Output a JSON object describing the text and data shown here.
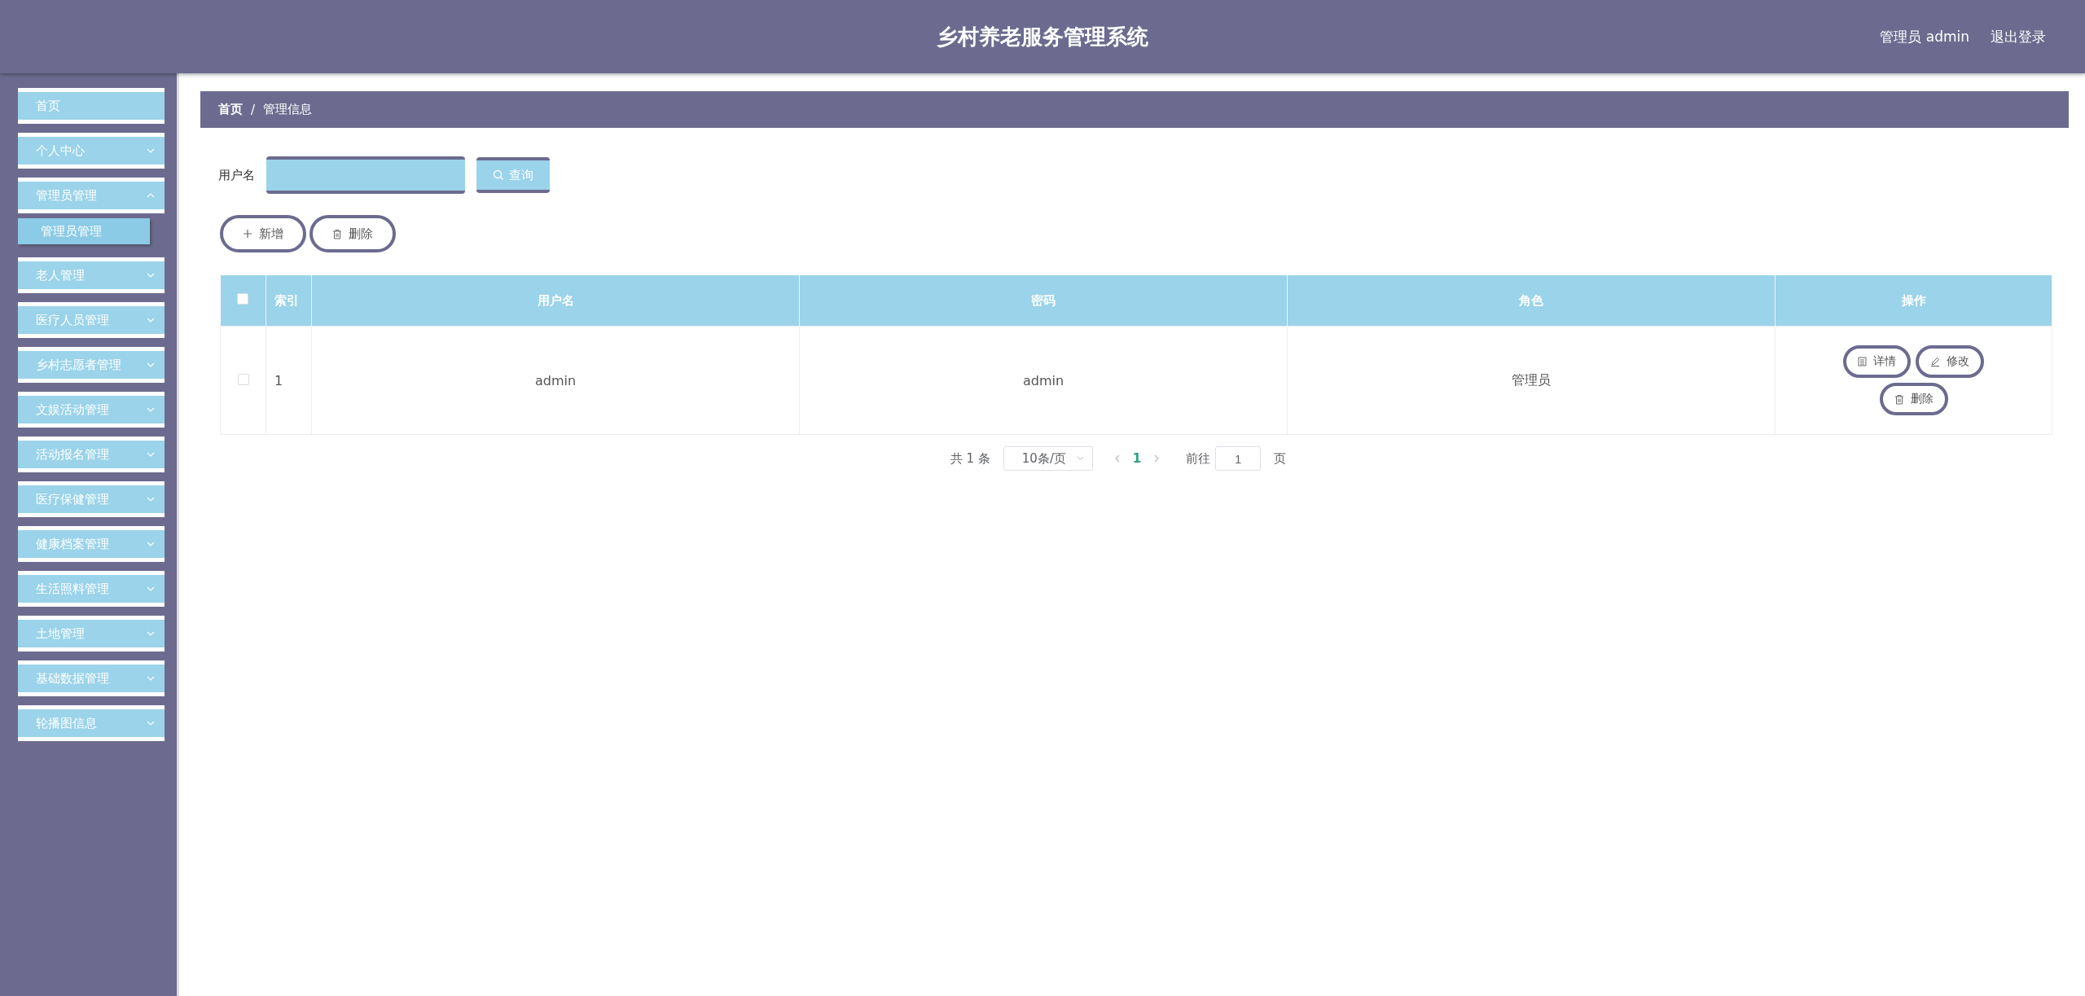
{
  "header": {
    "title": "乡村养老服务管理系统",
    "user": "管理员 admin",
    "logout": "退出登录"
  },
  "sidebar": {
    "items": [
      {
        "label": "首页",
        "kind": "link"
      },
      {
        "label": "个人中心",
        "kind": "menu",
        "expanded": false
      },
      {
        "label": "管理员管理",
        "kind": "menu",
        "expanded": true,
        "children": [
          {
            "label": "管理员管理",
            "selected": true
          }
        ]
      },
      {
        "label": "老人管理",
        "kind": "menu",
        "expanded": false
      },
      {
        "label": "医疗人员管理",
        "kind": "menu",
        "expanded": false
      },
      {
        "label": "乡村志愿者管理",
        "kind": "menu",
        "expanded": false
      },
      {
        "label": "文娱活动管理",
        "kind": "menu",
        "expanded": false
      },
      {
        "label": "活动报名管理",
        "kind": "menu",
        "expanded": false
      },
      {
        "label": "医疗保健管理",
        "kind": "menu",
        "expanded": false
      },
      {
        "label": "健康档案管理",
        "kind": "menu",
        "expanded": false
      },
      {
        "label": "生活照料管理",
        "kind": "menu",
        "expanded": false
      },
      {
        "label": "土地管理",
        "kind": "menu",
        "expanded": false
      },
      {
        "label": "基础数据管理",
        "kind": "menu",
        "expanded": false
      },
      {
        "label": "轮播图信息",
        "kind": "menu",
        "expanded": false
      }
    ]
  },
  "breadcrumb": [
    "首页",
    "管理信息"
  ],
  "breadcrumb_separator": "/",
  "search": {
    "label": "用户名",
    "button": "查询"
  },
  "actions": [
    {
      "label": "新增",
      "kind": "add"
    },
    {
      "label": "删除",
      "kind": "delete"
    }
  ],
  "table": {
    "select_all": {
      "checked": false
    },
    "columns": [
      "索引",
      "用户名",
      "密码",
      "角色",
      "操作"
    ],
    "rows": [
      {
        "checked": false,
        "cells": [
          "1",
          "admin",
          "admin",
          "管理员"
        ],
        "buttons": [
          {
            "label": "详情",
            "kind": "detail"
          },
          {
            "label": "修改",
            "kind": "edit"
          },
          {
            "label": "删除",
            "kind": "delete"
          }
        ]
      }
    ]
  },
  "pagination": {
    "total": "共 1 条",
    "page_size": "10条/页",
    "pages": [
      {
        "label": "1",
        "selected": true
      }
    ],
    "goto": "前往",
    "goto_value": "1",
    "page_unit": "页"
  }
}
